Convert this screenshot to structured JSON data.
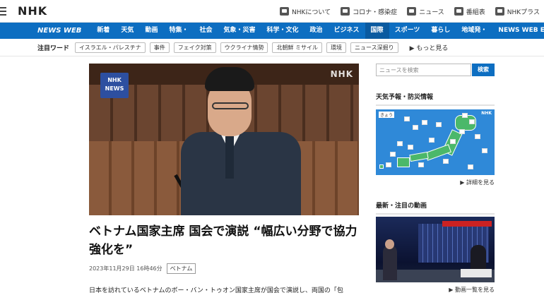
{
  "header": {
    "logo": "NHK",
    "links": [
      {
        "label": "NHKについて",
        "icon": "nhk-info-icon"
      },
      {
        "label": "コロナ・感染症",
        "icon": "corona-icon"
      },
      {
        "label": "ニュース",
        "icon": "news-icon"
      },
      {
        "label": "番組表",
        "icon": "program-guide-icon"
      },
      {
        "label": "NHKプラス",
        "icon": "nhk-plus-icon"
      }
    ]
  },
  "nav": {
    "brand": "NEWS WEB",
    "items": [
      "新着",
      "天気",
      "動画",
      "特集・",
      "社会",
      "気象・災害",
      "科学・文化",
      "政治",
      "ビジネス",
      "国際",
      "スポーツ",
      "暮らし",
      "地域発・",
      "NEWS WEB EASY"
    ],
    "active_index": 9
  },
  "keywords": {
    "label": "注目ワード",
    "tags": [
      "イスラエル・パレスチナ",
      "事件",
      "フェイク対策",
      "ウクライナ情勢",
      "北朝鮮 ミサイル",
      "環境",
      "ニュース深掘り"
    ],
    "more": "▶ もっと見る"
  },
  "article": {
    "badge_line1": "NHK",
    "badge_line2": "NEWS",
    "watermark": "NHK",
    "headline": "ベトナム国家主席 国会で演説 “幅広い分野で協力強化を”",
    "date": "2023年11月29日 16時46分",
    "tag": "ベトナム",
    "lead": "日本を訪れているベトナムのボー・バン・トゥオン国家主席が国会で演説し、両国の「包"
  },
  "sidebar": {
    "search_placeholder": "ニュースを検索",
    "search_button": "検索",
    "weather_heading": "天気予報・防災情報",
    "map_label": "きょう",
    "map_brand": "NHK",
    "weather_link": "▶ 詳細を見る",
    "video_heading": "最新・注目の動画",
    "video_link": "▶ 動画一覧を見る"
  },
  "colors": {
    "nav_blue": "#0d6ec1",
    "active_nav": "#0a5aa0",
    "map_sea": "#2f89d8",
    "map_land": "#4bb86a"
  }
}
